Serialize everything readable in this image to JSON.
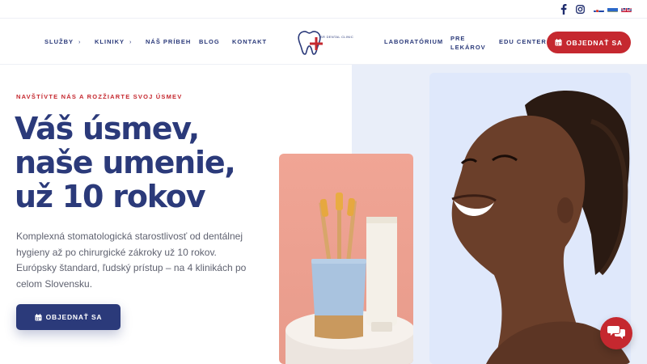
{
  "topbar": {
    "social": [
      {
        "name": "facebook-icon",
        "glyph": "f"
      },
      {
        "name": "instagram-icon",
        "glyph": "◎"
      }
    ],
    "flags": [
      "flag-sk-icon",
      "flag-ua-icon",
      "flag-gb-icon"
    ]
  },
  "nav": {
    "left": [
      {
        "label": "SLUŽBY",
        "has_chevron": true
      },
      {
        "label": "KLINIKY",
        "has_chevron": true
      },
      {
        "label": "NÁŠ PRÍBEH",
        "has_chevron": false
      },
      {
        "label": "BLOG",
        "has_chevron": false
      },
      {
        "label": "KONTAKT",
        "has_chevron": false
      }
    ],
    "right": [
      {
        "label": "LABORATÓRIUM"
      },
      {
        "label_line1": "PRE",
        "label_line2": "LEKÁROV"
      },
      {
        "label": "EDU CENTER"
      }
    ],
    "logo_text": "SR DENTAL CLINIC",
    "cta": "OBJEDNAŤ SA"
  },
  "hero": {
    "eyebrow": "NAVŠTÍVTE NÁS A ROZŽIARTE SVOJ ÚSMEV",
    "headline_lines": [
      "Váš úsmev,",
      "naše umenie,",
      "už 10 rokov"
    ],
    "paragraph": "Komplexná stomatologická starostlivosť od dentálnej hygieny až po chirurgické zákroky už 10 rokov. Európsky štandard, ľudský prístup – na 4 klinikách po celom Slovensku.",
    "cta": "OBJEDNAŤ SA"
  },
  "colors": {
    "brand_blue": "#2b3a7a",
    "brand_red": "#c5282f",
    "hero_bg": "#e9eef9"
  },
  "chat": {
    "icon": "chat-icon"
  }
}
